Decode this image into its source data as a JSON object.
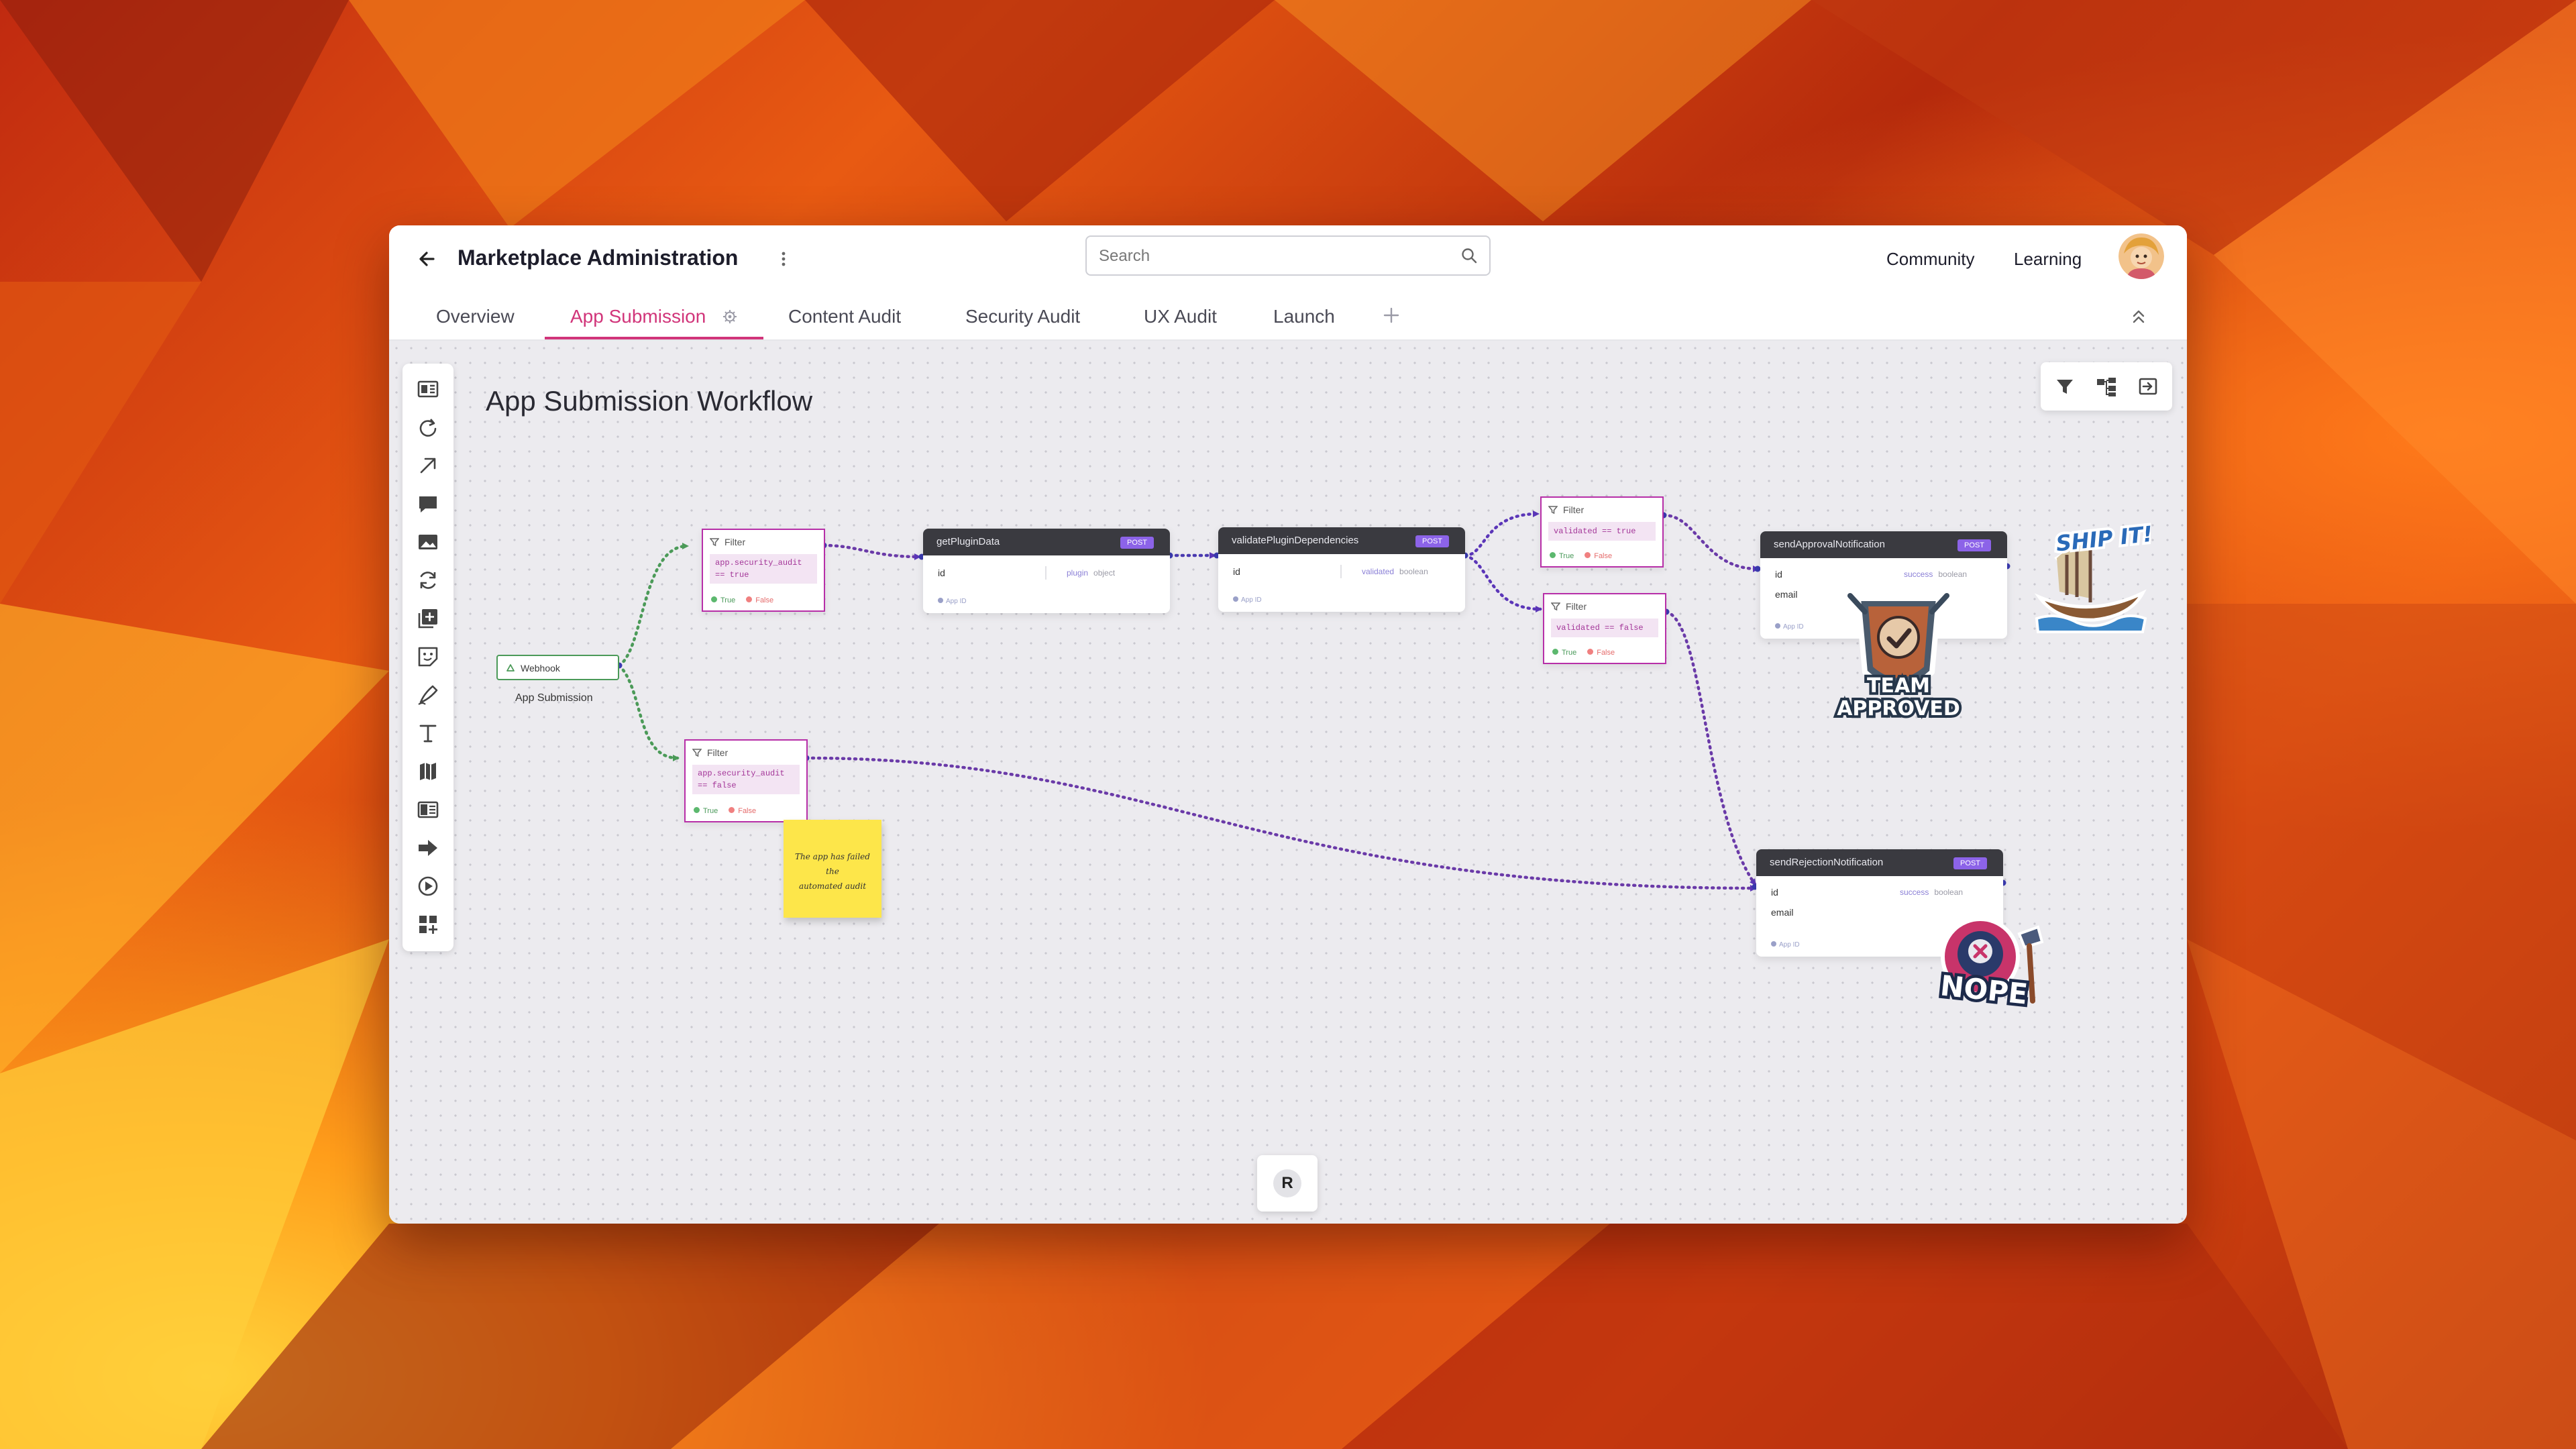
{
  "header": {
    "title": "Marketplace Administration",
    "search_placeholder": "Search",
    "nav": {
      "community": "Community",
      "learning": "Learning"
    }
  },
  "tabs": [
    {
      "label": "Overview"
    },
    {
      "label": "App Submission",
      "active": true
    },
    {
      "label": "Content Audit"
    },
    {
      "label": "Security Audit"
    },
    {
      "label": "UX Audit"
    },
    {
      "label": "Launch"
    }
  ],
  "canvas": {
    "title": "App Submission Workflow",
    "run_button": "R"
  },
  "nodes": {
    "webhook": {
      "label": "Webhook",
      "caption": "App Submission"
    },
    "filter_pass": {
      "label": "Filter",
      "condition": "app.security_audit == true",
      "true_label": "True",
      "false_label": "False"
    },
    "filter_fail": {
      "label": "Filter",
      "condition": "app.security_audit == false",
      "true_label": "True",
      "false_label": "False"
    },
    "get_plugin_data": {
      "name": "getPluginData",
      "method": "POST",
      "field": "id",
      "response": "plugin",
      "response_type": "object",
      "footer": "App ID"
    },
    "validate_deps": {
      "name": "validatePluginDependencies",
      "method": "POST",
      "field": "id",
      "response": "validated",
      "response_type": "boolean",
      "footer": "App ID"
    },
    "filter_valid": {
      "label": "Filter",
      "condition": "validated == true",
      "true_label": "True",
      "false_label": "False"
    },
    "filter_invalid": {
      "label": "Filter",
      "condition": "validated == false",
      "true_label": "True",
      "false_label": "False"
    },
    "send_approval": {
      "name": "sendApprovalNotification",
      "method": "POST",
      "field1": "id",
      "field2": "email",
      "response": "success",
      "response_type": "boolean",
      "footer": "App ID"
    },
    "send_rejection": {
      "name": "sendRejectionNotification",
      "method": "POST",
      "field1": "id",
      "field2": "email",
      "response": "success",
      "response_type": "boolean",
      "footer": "App ID"
    }
  },
  "sticky_note": {
    "line1": "The app has failed the",
    "line2": "automated audit"
  },
  "stickers": {
    "approved_line1": "TEAM",
    "approved_line2": "APPROVED",
    "ship_it": "SHIP IT!",
    "nope": "NOPE"
  },
  "colors": {
    "accent": "#d1357a",
    "filter_border": "#b72fa8",
    "edge": "#6a3aa8",
    "webhook_border": "#4b9a58",
    "method_badge": "#8c63e8"
  }
}
